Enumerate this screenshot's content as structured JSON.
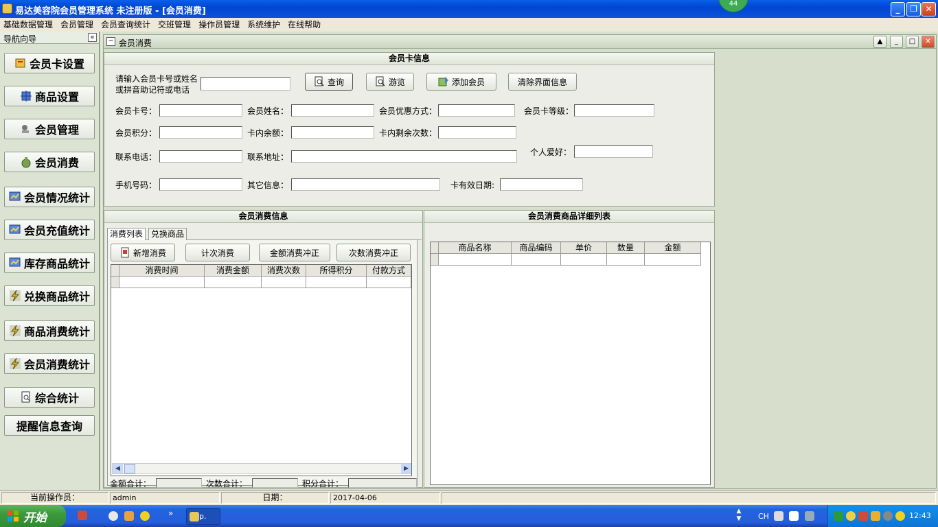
{
  "window": {
    "title": "易达美容院会员管理系统 未注册版    - [会员消费]",
    "badge": "44"
  },
  "menu": [
    "基础数据管理",
    "会员管理",
    "会员查询统计",
    "交班管理",
    "操作员管理",
    "系统维护",
    "在线帮助"
  ],
  "nav": {
    "header": "导航向导",
    "collapse": "«",
    "items": [
      "会员卡设置",
      "商品设置",
      "会员管理",
      "会员消费",
      "会员情况统计",
      "会员充值统计",
      "库存商品统计",
      "兑换商品统计",
      "商品消费统计",
      "会员消费统计",
      "综合统计",
      "提醒信息查询"
    ]
  },
  "child": {
    "title": "会员消费"
  },
  "card": {
    "header": "会员卡信息",
    "search_label_1": "请输入会员卡号或姓名",
    "search_label_2": "或拼音助记符或电话",
    "search_value": "",
    "btn_query": "查询",
    "btn_browse": "游览",
    "btn_add": "添加会员",
    "btn_clear": "清除界面信息",
    "fields": {
      "card_no": "会员卡号：",
      "name": "会员姓名：",
      "discount": "会员优惠方式：",
      "level": "会员卡等级：",
      "points": "会员积分：",
      "balance": "卡内余额：",
      "remaining": "卡内剩余次数：",
      "phone": "联系电话：",
      "address": "联系地址：",
      "hobby": "个人爱好：",
      "mobile": "手机号码：",
      "other": "其它信息：",
      "expiry": "卡有效日期:"
    }
  },
  "consume": {
    "header": "会员消费信息",
    "tabs": [
      "消费列表",
      "兑换商品"
    ],
    "btn_new": "新增消费",
    "btn_count": "计次消费",
    "btn_amount_reverse": "金额消费冲正",
    "btn_count_reverse": "次数消费冲正",
    "columns": [
      "消费时间",
      "消费金额",
      "消费次数",
      "所得积分",
      "付款方式"
    ],
    "sum_amount": "金额合计：",
    "sum_count": "次数合计：",
    "sum_points": "积分合计："
  },
  "detail": {
    "header": "会员消费商品详细列表",
    "columns": [
      "商品名称",
      "商品编码",
      "单价",
      "数量",
      "金额"
    ]
  },
  "status": {
    "operator_label": "当前操作员：",
    "operator": "admin",
    "date_label": "日期：",
    "date": "2017-04-06"
  },
  "taskbar": {
    "start": "开始",
    "item": "p.",
    "lang": "CH",
    "time": "12:43",
    "chevron": "»"
  }
}
